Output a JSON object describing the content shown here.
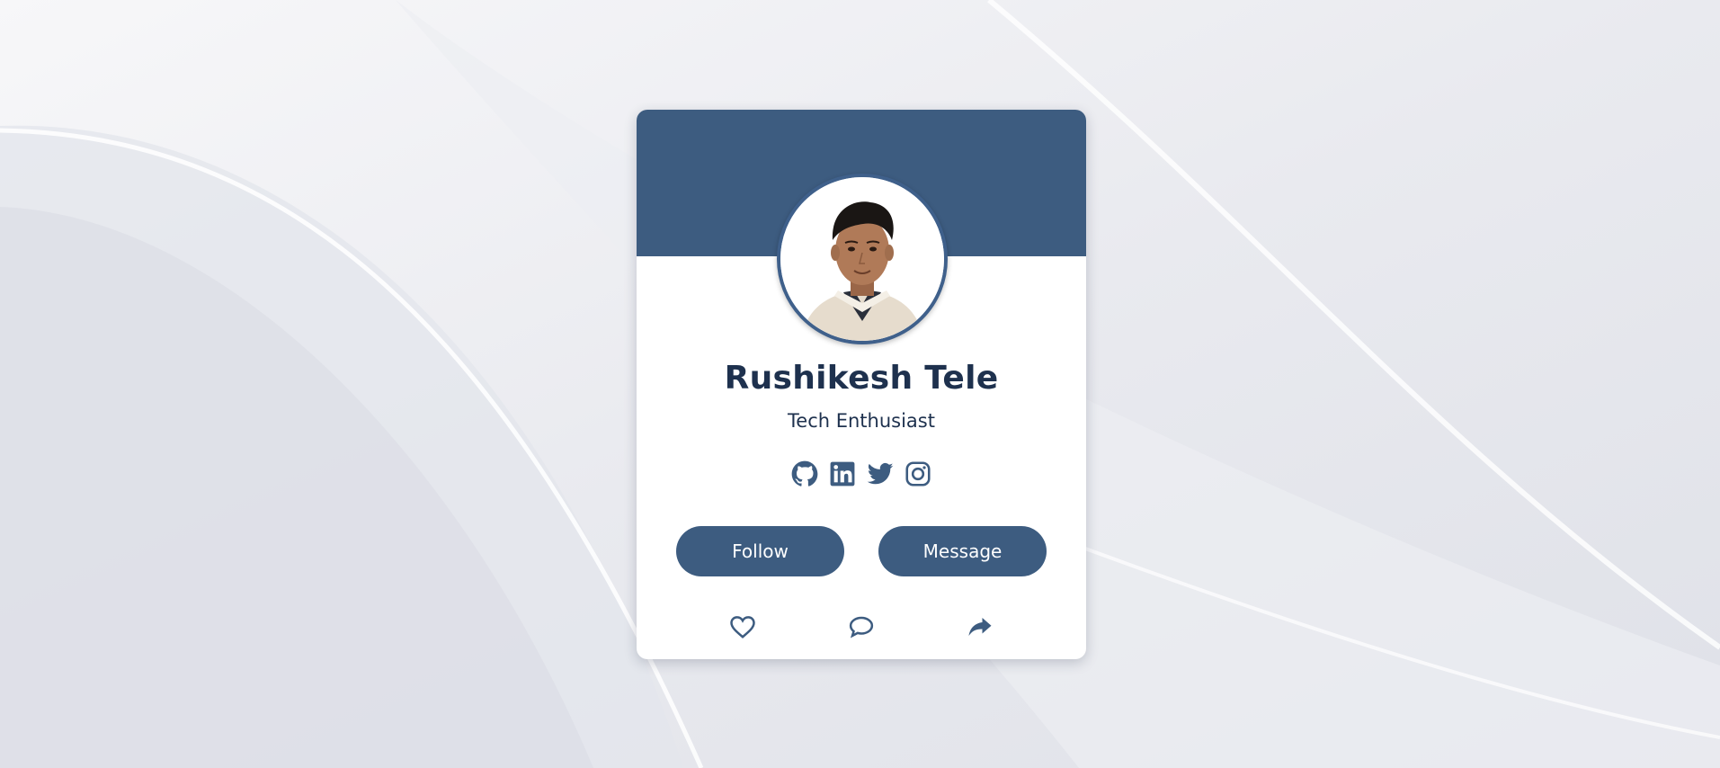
{
  "theme": {
    "accent": "#3d5c80",
    "name_color": "#1e314e",
    "card_bg": "#ffffff",
    "page_bg": "#eeeff3"
  },
  "profile": {
    "name": "Rushikesh Tele",
    "title": "Tech Enthusiast",
    "avatar_icon": "profile-photo"
  },
  "socials": [
    {
      "icon": "github-icon"
    },
    {
      "icon": "linkedin-icon"
    },
    {
      "icon": "twitter-icon"
    },
    {
      "icon": "instagram-icon"
    }
  ],
  "buttons": {
    "follow_label": "Follow",
    "message_label": "Message"
  },
  "actions": [
    {
      "icon": "heart-icon"
    },
    {
      "icon": "comment-icon"
    },
    {
      "icon": "share-icon"
    }
  ]
}
